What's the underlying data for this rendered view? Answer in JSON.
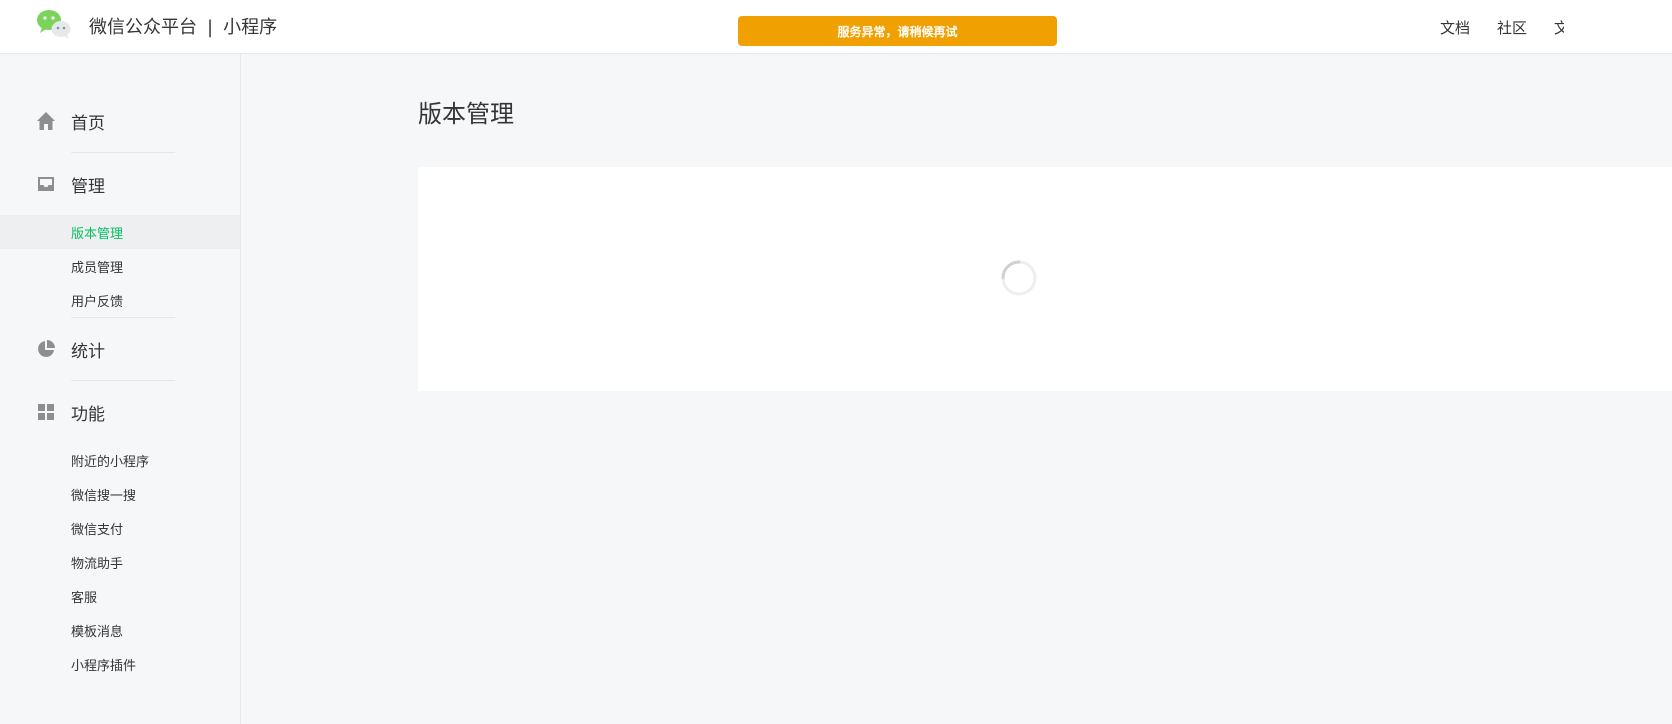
{
  "header": {
    "brand_name": "微信公众平台",
    "separator": "|",
    "product_name": "小程序",
    "alert_text": "服务异常，请稍候再试",
    "links": [
      {
        "label": "文档"
      },
      {
        "label": "社区"
      },
      {
        "label": "文"
      }
    ],
    "logo_icon": "wechat-logo-icon"
  },
  "sidebar": {
    "groups": [
      {
        "label": "首页",
        "icon": "home-icon",
        "items": []
      },
      {
        "label": "管理",
        "icon": "inbox-icon",
        "items": [
          {
            "label": "版本管理",
            "active": true
          },
          {
            "label": "成员管理"
          },
          {
            "label": "用户反馈"
          }
        ]
      },
      {
        "label": "统计",
        "icon": "pie-chart-icon",
        "items": []
      },
      {
        "label": "功能",
        "icon": "grid-icon",
        "items": [
          {
            "label": "附近的小程序"
          },
          {
            "label": "微信搜一搜"
          },
          {
            "label": "微信支付"
          },
          {
            "label": "物流助手"
          },
          {
            "label": "客服"
          },
          {
            "label": "模板消息"
          },
          {
            "label": "小程序插件"
          }
        ]
      }
    ]
  },
  "main": {
    "page_title": "版本管理",
    "loading_icon": "loading-spinner-icon"
  },
  "colors": {
    "accent_green": "#07c160",
    "alert_orange": "#f0a000",
    "background": "#f6f7f9"
  }
}
